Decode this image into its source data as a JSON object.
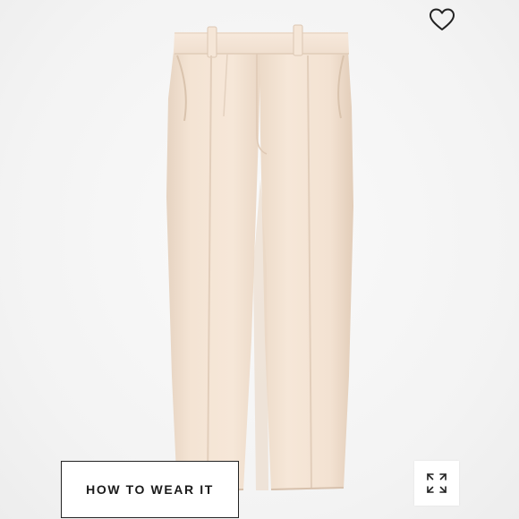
{
  "product": {
    "image_subject": "cream-trousers",
    "fabric_color": "#f3e2d2",
    "background_color": "#f5f5f5"
  },
  "actions": {
    "how_to_wear_label": "HOW TO WEAR IT",
    "wishlist_icon": "heart-outline-icon",
    "expand_icon": "expand-arrows-icon"
  }
}
